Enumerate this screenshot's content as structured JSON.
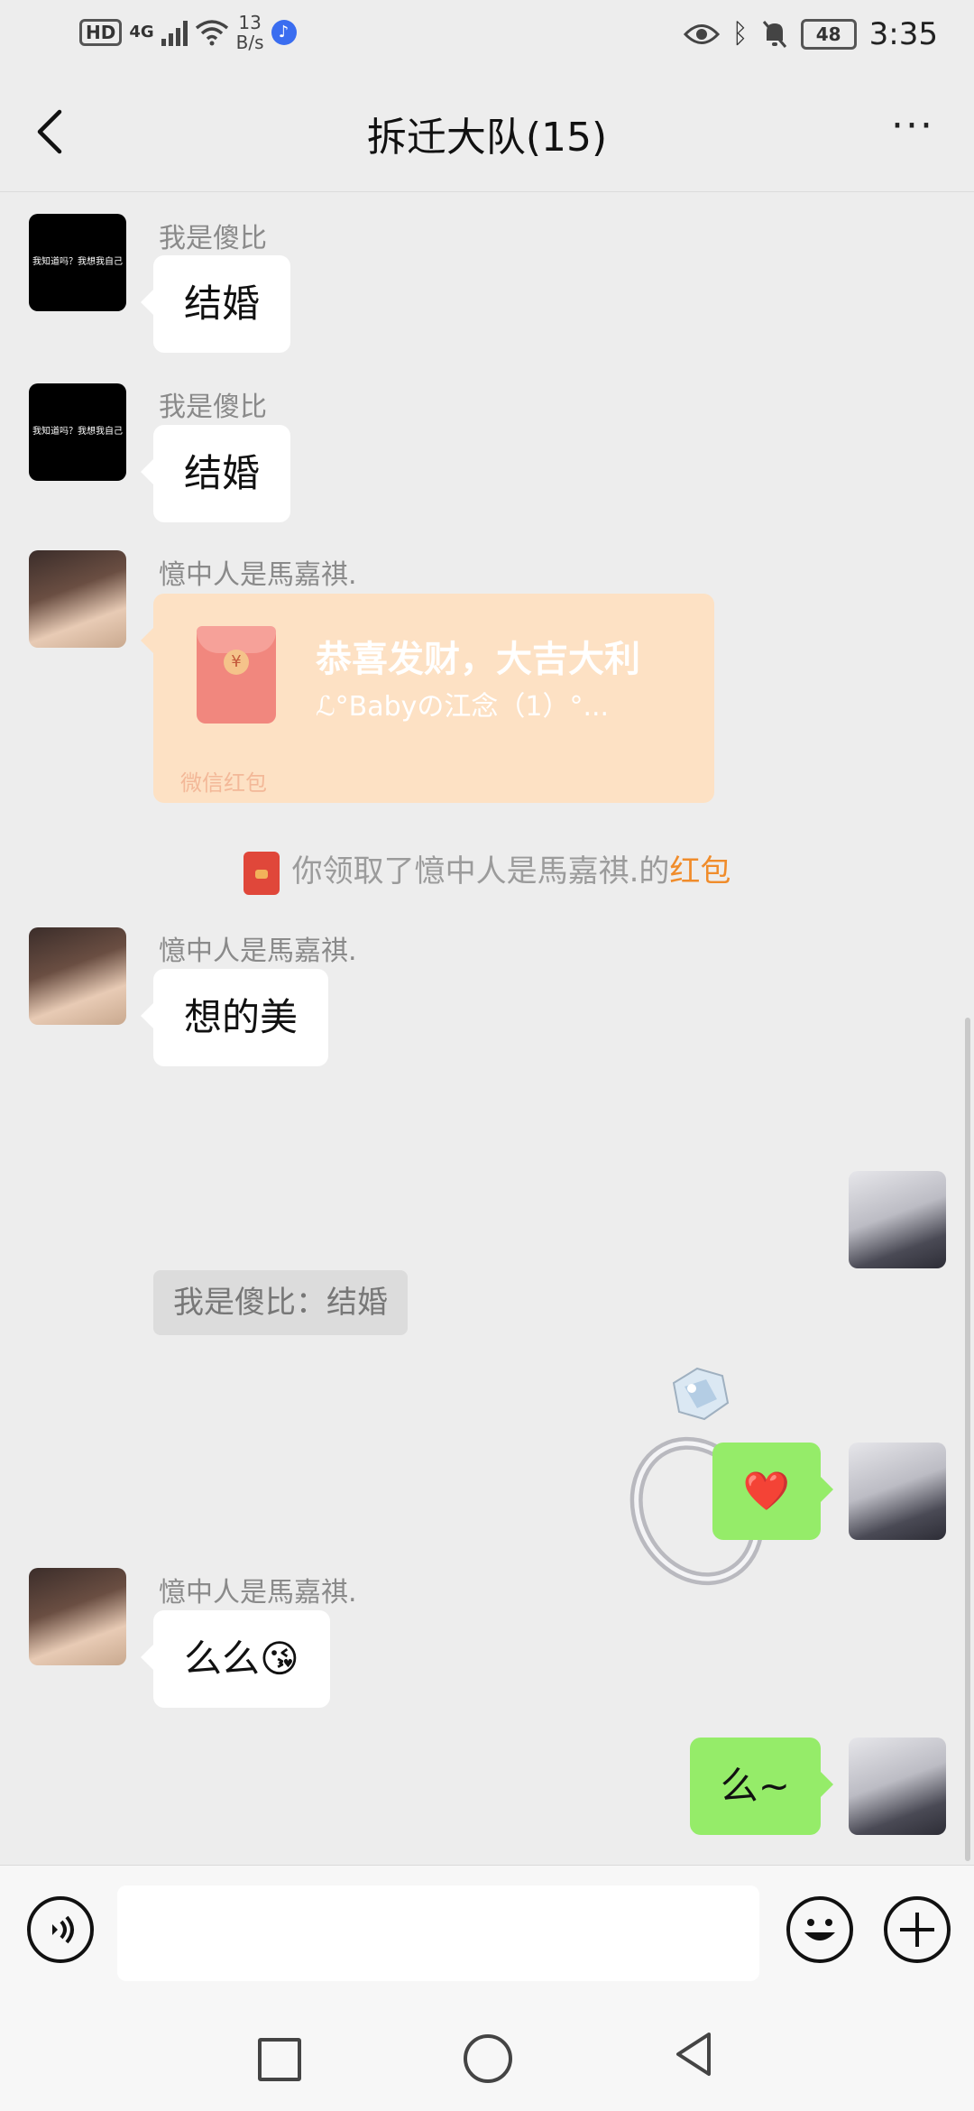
{
  "status_bar": {
    "hd": "HD",
    "network": "4G",
    "speed_value": "13",
    "speed_unit": "B/s",
    "battery": "48",
    "time": "3:35"
  },
  "header": {
    "title": "拆迁大队(15)",
    "more_label": "···"
  },
  "messages": {
    "m1": {
      "sender": "我是傻比",
      "text": "结婚",
      "avatar_text": "我知道吗？我想我自己"
    },
    "m2": {
      "sender": "我是傻比",
      "text": "结婚",
      "avatar_text": "我知道吗？我想我自己"
    },
    "m3": {
      "sender": "憶中人是馬嘉祺.",
      "red_packet": {
        "title": "恭喜发财，大吉大利",
        "subtitle": "ℒ°Babyの江念（1）°...",
        "footer": "微信红包",
        "symbol": "¥"
      }
    },
    "system": {
      "text": "你领取了憶中人是馬嘉祺.的",
      "link": "红包"
    },
    "m4": {
      "sender": "憶中人是馬嘉祺.",
      "text": "想的美",
      "quote": "我是傻比：结婚"
    },
    "m5": {
      "type": "sticker",
      "sticker": "diamond-ring"
    },
    "m6": {
      "text": "❤️"
    },
    "m7": {
      "sender": "憶中人是馬嘉祺.",
      "text": "么么😘"
    },
    "m8": {
      "text": "么~"
    }
  },
  "input_bar": {
    "voice_icon": "voice-icon",
    "emoji_icon": "emoji-icon",
    "plus_icon": "plus-icon"
  },
  "colors": {
    "background": "#ededed",
    "green_bubble": "#95ec69",
    "red_packet": "#fde1c4",
    "link_orange": "#f08c2b"
  }
}
